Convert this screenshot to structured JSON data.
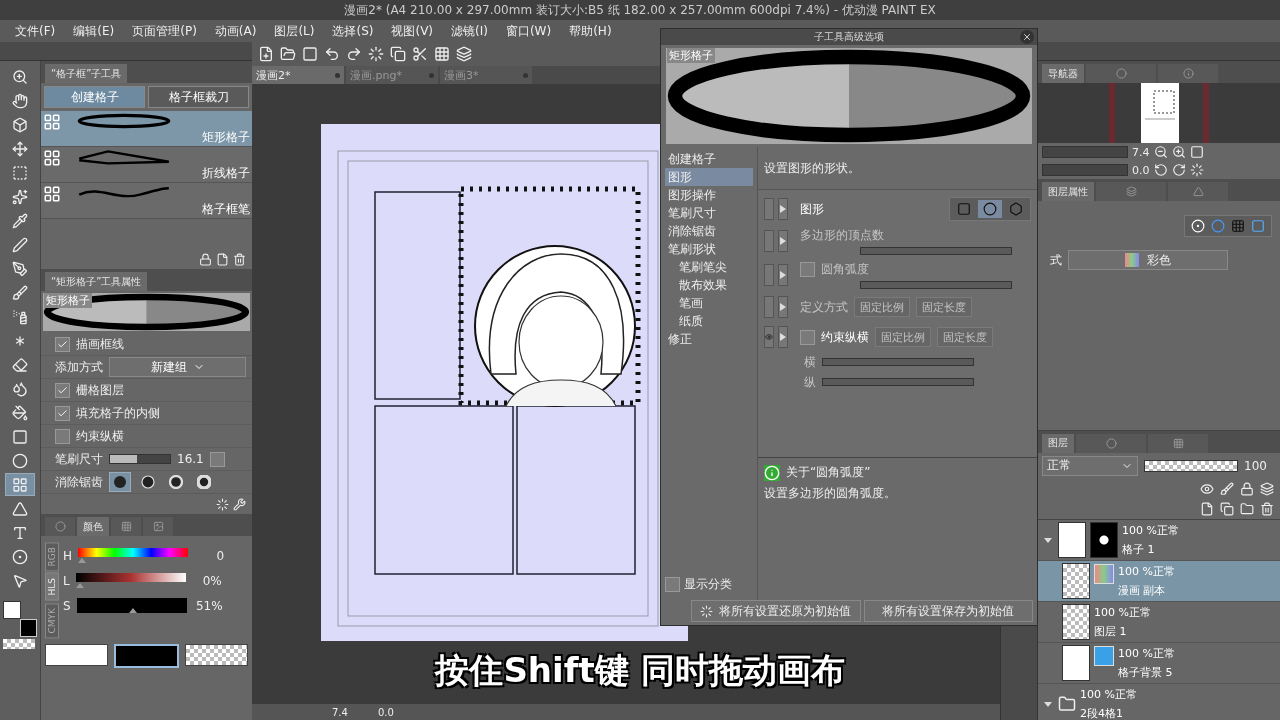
{
  "window": {
    "title": "漫画2* (A4 210.00 x 297.00mm 装订大小:B5 纸 182.00 x 257.00mm 600dpi 7.4%) - 优动漫 PAINT EX"
  },
  "menu": [
    "文件(F)",
    "编辑(E)",
    "页面管理(P)",
    "动画(A)",
    "图层(L)",
    "选择(S)",
    "视图(V)",
    "滤镜(I)",
    "窗口(W)",
    "帮助(H)"
  ],
  "tools": [
    {
      "selected": false
    },
    {
      "selected": false
    },
    {
      "selected": false
    },
    {
      "selected": false
    },
    {
      "selected": false
    },
    {
      "selected": false
    },
    {
      "selected": false
    },
    {
      "selected": false
    },
    {
      "selected": false
    },
    {
      "selected": false
    },
    {
      "selected": false
    },
    {
      "selected": false
    },
    {
      "selected": false
    },
    {
      "selected": false
    },
    {
      "selected": false
    },
    {
      "selected": false
    },
    {
      "selected": false
    },
    {
      "selected": true
    },
    {
      "selected": false
    },
    {
      "selected": false
    },
    {
      "selected": false
    },
    {
      "selected": false
    }
  ],
  "subtool_panel": {
    "title": "“格子框”子工具",
    "groups": [
      {
        "label": "创建格子",
        "selected": true
      },
      {
        "label": "格子框裁刀",
        "selected": false
      }
    ],
    "items": [
      {
        "label": "矩形格子",
        "kind": "ellipse",
        "selected": true
      },
      {
        "label": "折线格子",
        "kind": "polyline",
        "selected": false
      },
      {
        "label": "格子框笔",
        "kind": "wave",
        "selected": false
      }
    ]
  },
  "tool_property": {
    "title": "“矩形格子”工具属性",
    "preview_label": "矩形格子",
    "options": [
      {
        "kind": "checkbox",
        "label": "描画框线",
        "checked": true
      },
      {
        "kind": "select",
        "label": "添加方式",
        "value": "新建组"
      },
      {
        "kind": "checkbox",
        "label": "栅格图层",
        "checked": true
      },
      {
        "kind": "checkbox",
        "label": "填充格子的内侧",
        "checked": true
      },
      {
        "kind": "checkbox",
        "label": "约束纵横",
        "checked": false
      },
      {
        "kind": "slider",
        "label": "笔刷尺寸",
        "value": "16.1",
        "level": 0.45
      },
      {
        "kind": "antialias",
        "label": "消除锯齿",
        "options": [
          {
            "selected": true
          },
          {
            "selected": false
          },
          {
            "selected": false
          },
          {
            "selected": false
          }
        ]
      }
    ]
  },
  "color_panel": {
    "tab": "颜色",
    "modes": [
      {
        "label": "RGB",
        "selected": false
      },
      {
        "label": "HLS",
        "selected": true
      },
      {
        "label": "CMYK",
        "selected": false
      }
    ],
    "sliders": [
      {
        "label": "H",
        "kind": "hue",
        "value": "0",
        "level": 0
      },
      {
        "label": "L",
        "kind": "light",
        "value": "0%",
        "level": 0
      },
      {
        "label": "S",
        "kind": "sat",
        "value": "51%",
        "level": 0.51
      }
    ]
  },
  "doc_tabs": [
    {
      "label": "漫画2*",
      "selected": true
    },
    {
      "label": "漫画.png*",
      "selected": false
    },
    {
      "label": "漫画3*",
      "selected": false
    }
  ],
  "canvas": {
    "zoom": "7.4",
    "angle": "0.0"
  },
  "dialog": {
    "title": "子工具高级选项",
    "preview_label": "矩形格子",
    "categories": [
      {
        "label": "创建格子",
        "selected": false
      },
      {
        "label": "图形",
        "selected": true
      },
      {
        "label": "图形操作",
        "selected": false
      },
      {
        "label": "笔刷尺寸",
        "selected": false
      },
      {
        "label": "消除锯齿",
        "selected": false
      },
      {
        "label": "笔刷形状",
        "selected": false,
        "children": [
          {
            "label": "笔刷笔尖",
            "selected": false
          },
          {
            "label": "散布效果",
            "selected": false
          },
          {
            "label": "笔画",
            "selected": false
          },
          {
            "label": "纸质",
            "selected": false
          }
        ]
      },
      {
        "label": "修正",
        "selected": false
      }
    ],
    "description": "设置图形的形状。",
    "settings": [
      {
        "kind": "shape",
        "label": "图形",
        "disabled": false,
        "shapes": [
          {
            "selected": false
          },
          {
            "selected": true
          },
          {
            "selected": false
          }
        ]
      },
      {
        "kind": "slider",
        "label": "多边形的顶点数",
        "disabled": true
      },
      {
        "kind": "check_slider",
        "label": "圆角弧度",
        "checked": false,
        "disabled": true
      },
      {
        "kind": "buttons",
        "label": "定义方式",
        "disabled": true,
        "buttons": [
          "固定比例",
          "固定长度"
        ]
      },
      {
        "kind": "check_buttons",
        "label": "约束纵横",
        "checked": false,
        "disabled": false,
        "buttons": [
          "固定比例",
          "固定长度"
        ]
      },
      {
        "kind": "slider",
        "label": "横",
        "disabled": true
      },
      {
        "kind": "slider",
        "label": "纵",
        "disabled": true
      }
    ],
    "info_title": "关于“圆角弧度”",
    "info_text": "设置多边形的圆角弧度。",
    "show_category": {
      "label": "显示分类",
      "checked": false
    },
    "buttons": [
      "将所有设置还原为初始值",
      "将所有设置保存为初始值"
    ]
  },
  "navigator": {
    "tab": "导航器",
    "zoom": "7.4",
    "angle": "0.0"
  },
  "layer_property": {
    "tab": "图层属性",
    "label": "式",
    "value": "彩色"
  },
  "layers_panel": {
    "tab": "图层",
    "blend": "正常",
    "opacity": "100",
    "layers": [
      {
        "kind": "frame",
        "opacity": "100 %正常",
        "name": "格子 1",
        "expanded": true,
        "selected": false,
        "children": [
          {
            "kind": "color_raster",
            "opacity": "100 %正常",
            "name": "漫画 副本",
            "selected": true
          },
          {
            "kind": "raster",
            "opacity": "100 %正常",
            "name": "图层 1",
            "selected": false
          },
          {
            "kind": "fill",
            "opacity": "100 %正常",
            "name": "格子背景 5",
            "selected": false
          }
        ]
      },
      {
        "kind": "folder",
        "opacity": "100 %正常",
        "name": "2段4格1",
        "expanded": true,
        "selected": false
      }
    ]
  },
  "subtitle": "按住Shift键 同时拖动画布"
}
